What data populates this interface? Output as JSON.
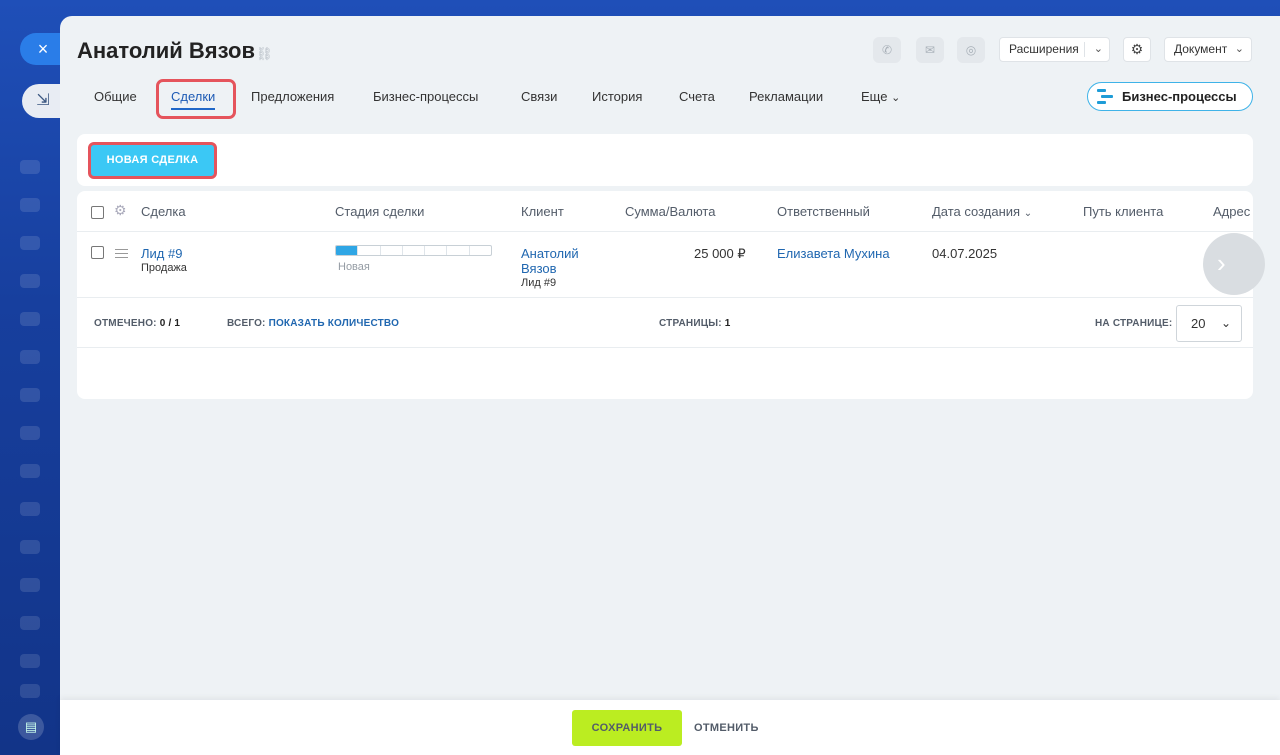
{
  "window": {
    "title": "Анатолий Вязов",
    "close_icon": "×",
    "side_icon": "⇲"
  },
  "header": {
    "extensions_label": "Расширения",
    "document_label": "Документ"
  },
  "tabs": [
    {
      "label": "Общие"
    },
    {
      "label": "Сделки",
      "active": true
    },
    {
      "label": "Предложения"
    },
    {
      "label": "Бизнес-процессы"
    },
    {
      "label": "Связи"
    },
    {
      "label": "История"
    },
    {
      "label": "Счета"
    },
    {
      "label": "Рекламации"
    },
    {
      "label": "Еще"
    }
  ],
  "business_process_button": "Бизнес-процессы",
  "toolbar": {
    "new_deal_label": "НОВАЯ СДЕЛКА"
  },
  "grid": {
    "columns": [
      "Сделка",
      "Стадия сделки",
      "Клиент",
      "Сумма/Валюта",
      "Ответственный",
      "Дата создания",
      "Путь клиента",
      "Адрес"
    ],
    "rows": [
      {
        "deal_title": "Лид #9",
        "deal_type": "Продажа",
        "stage": "Новая",
        "stage_progress_segments": 1,
        "stage_total_segments": 7,
        "client_name_line1": "Анатолий",
        "client_name_line2": "Вязов",
        "client_sub": "Лид #9",
        "amount": "25 000 ₽",
        "responsible": "Елизавета Мухина",
        "created": "04.07.2025"
      }
    ]
  },
  "footer": {
    "selected_label": "ОТМЕЧЕНО:",
    "selected_value": "0 / 1",
    "total_label": "ВСЕГО:",
    "total_link": "ПОКАЗАТЬ КОЛИЧЕСТВО",
    "pages_label": "СТРАНИЦЫ:",
    "pages_value": "1",
    "per_page_label": "НА СТРАНИЦЕ:",
    "per_page_value": "20"
  },
  "bottom_bar": {
    "save_label": "СОХРАНИТЬ",
    "cancel_label": "ОТМЕНИТЬ"
  },
  "colors": {
    "accent": "#3bc8f5",
    "save": "#bbed21",
    "highlight": "#e5545c",
    "link": "#2067b0"
  }
}
